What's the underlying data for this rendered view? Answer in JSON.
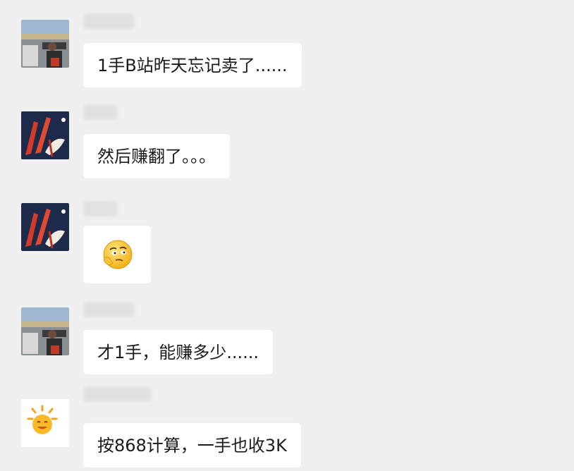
{
  "chat": {
    "messages": [
      {
        "sender": "beach-photo-user",
        "text": "1手B站昨天忘记卖了......"
      },
      {
        "sender": "red-art-user",
        "text": "然后赚翻了。。。"
      },
      {
        "sender": "red-art-user",
        "text": "",
        "emoji": "thinking-face-emoji"
      },
      {
        "sender": "beach-photo-user",
        "text": "才1手，能赚多少......"
      },
      {
        "sender": "sun-avatar-user",
        "text": "按868计算，一手也收3K"
      }
    ]
  },
  "colors": {
    "background": "#f0f0f0",
    "bubble": "#ffffff",
    "text": "#1a1a1a"
  }
}
